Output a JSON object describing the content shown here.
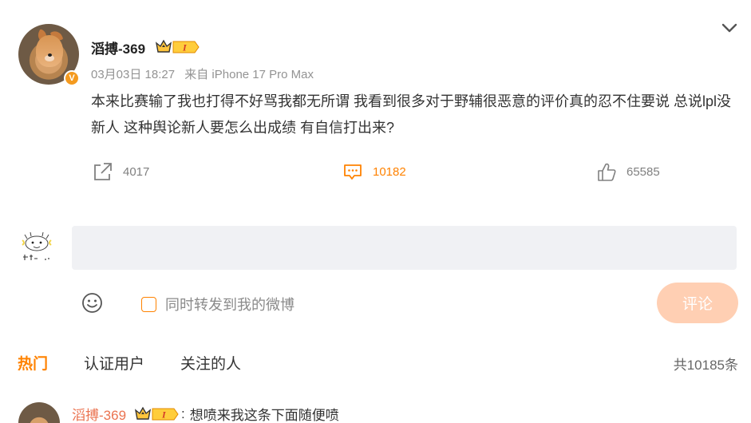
{
  "post": {
    "username": "滔搏-369",
    "vip_level": "I",
    "time": "03月03日 18:27",
    "source": "来自 iPhone 17 Pro Max",
    "content": "本来比赛输了我也打得不好骂我都无所谓 我看到很多对于野辅很恶意的评价真的忍不住要说 总说lpl没新人 这种舆论新人要怎么出成绩 有自信打出来?",
    "verified_mark": "V",
    "actions": {
      "repost_count": "4017",
      "comment_count": "10182",
      "like_count": "65585"
    }
  },
  "composer": {
    "placeholder": "",
    "sync_label": "同时转发到我的微博",
    "submit_label": "评论"
  },
  "comments": {
    "tabs": [
      {
        "label": "热门",
        "active": true
      },
      {
        "label": "认证用户",
        "active": false
      },
      {
        "label": "关注的人",
        "active": false
      }
    ],
    "total": "共10185条",
    "first": {
      "username": "滔搏-369",
      "vip_level": "I",
      "separator": ":",
      "text": "想喷来我这条下面随便喷"
    }
  },
  "colors": {
    "accent": "#ff8200",
    "username_reply": "#eb7350",
    "submit_bg": "#ffcfb3",
    "input_bg": "#f0f1f4"
  },
  "icons": [
    "chevron-down-icon",
    "verified-icon",
    "vip-crown-icon",
    "repost-icon",
    "comment-icon",
    "like-icon",
    "emoji-icon"
  ]
}
